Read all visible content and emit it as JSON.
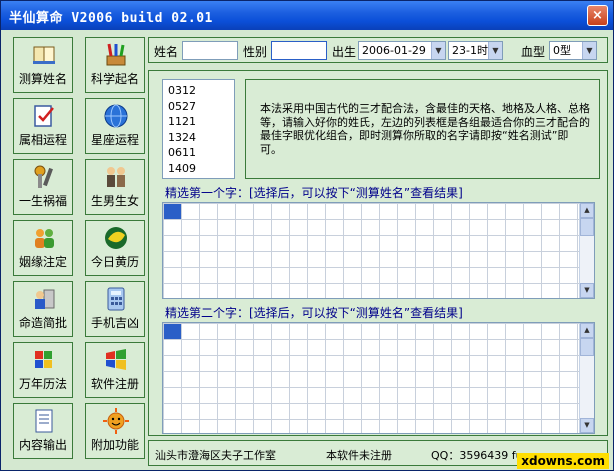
{
  "window": {
    "title": "半仙算命 V2006 build 02.01",
    "close_label": "×"
  },
  "left_buttons": [
    {
      "label": "测算姓名",
      "icon": "book-icon"
    },
    {
      "label": "科学起名",
      "icon": "pencils-icon"
    },
    {
      "label": "属相运程",
      "icon": "notepad-check-icon"
    },
    {
      "label": "星座运程",
      "icon": "globe-icon"
    },
    {
      "label": "一生祸福",
      "icon": "tools-icon"
    },
    {
      "label": "生男生女",
      "icon": "people-icon"
    },
    {
      "label": "姻缘注定",
      "icon": "users-icon"
    },
    {
      "label": "今日黄历",
      "icon": "calendar-leaf-icon"
    },
    {
      "label": "命造简批",
      "icon": "user-panel-icon"
    },
    {
      "label": "手机吉凶",
      "icon": "calculator-icon"
    },
    {
      "label": "万年历法",
      "icon": "windows-flag-icon"
    },
    {
      "label": "软件注册",
      "icon": "windows-logo-icon"
    },
    {
      "label": "内容输出",
      "icon": "document-icon"
    },
    {
      "label": "附加功能",
      "icon": "sun-icon"
    }
  ],
  "form": {
    "name_label": "姓名",
    "name_value": "",
    "gender_label": "性别",
    "gender_value": "",
    "birth_label": "出生",
    "birth_date": "2006-01-29",
    "birth_hour": "23-1时",
    "blood_label": "血型",
    "blood_value": "0型"
  },
  "list_values": [
    "0312",
    "0527",
    "1121",
    "1324",
    "0611",
    "1409"
  ],
  "description": "本法采用中国古代的三才配合法，含最佳的天格、地格及人格、总格等，请输入好你的姓氏，左边的列表框是各组最适合你的三才配合的最佳字眼优化组合，即时测算你所取的名字请即按“姓名测试”即可。",
  "section1_label": "精选第一个字：[选择后，可以按下“测算姓名”查看结果]",
  "section2_label": "精选第二个字：[选择后，可以按下“测算姓名”查看结果]",
  "status": {
    "company": "汕头市澄海区夫子工作室",
    "registration": "本软件未注册",
    "qq": "QQ：3596439 fuz"
  },
  "watermark": "xdowns.com"
}
